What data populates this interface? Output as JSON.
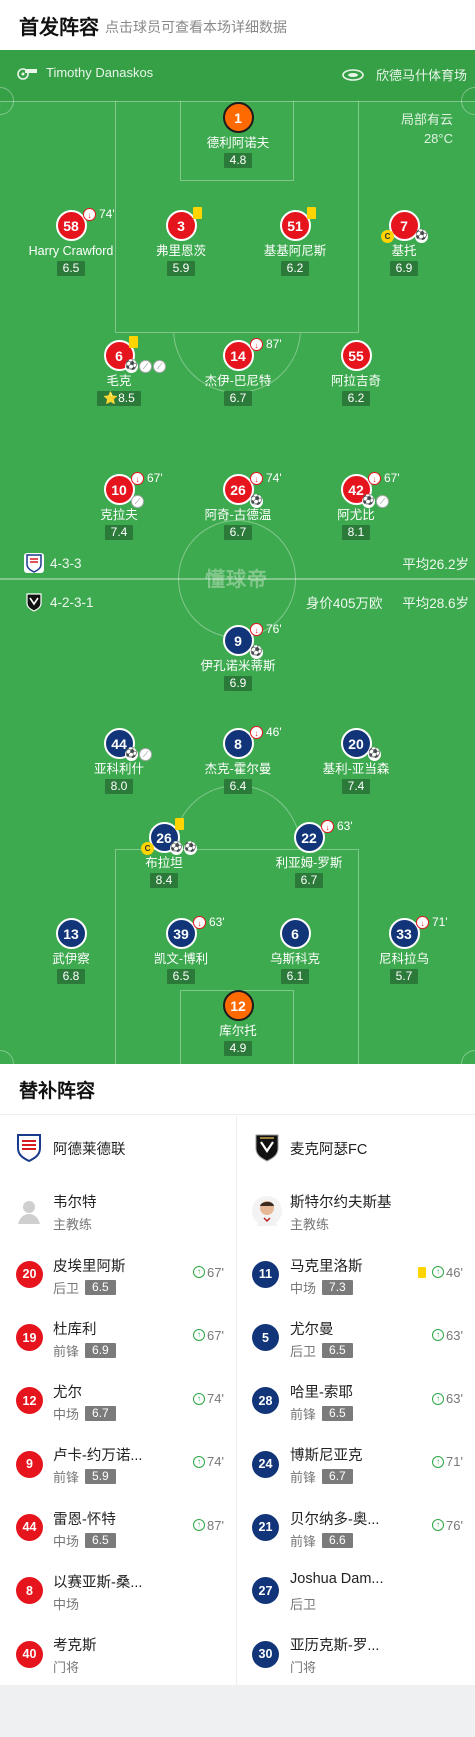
{
  "header": {
    "title": "首发阵容",
    "subtitle": "点击球员可查看本场详细数据"
  },
  "info": {
    "referee": "Timothy Danaskos",
    "venue": "欣德马什体育场",
    "weather": "局部有云",
    "temperature": "28°C"
  },
  "watermark": "懂球帝",
  "home": {
    "formation": "4-3-3",
    "avg_age": "平均26.2岁",
    "players": [
      {
        "num": "1",
        "name": "德利阿诺夫",
        "rating": "4.8",
        "color": "orange"
      },
      {
        "num": "58",
        "name": "Harry Crawford",
        "rating": "6.5",
        "sub_min": "74'",
        "color": "red"
      },
      {
        "num": "3",
        "name": "弗里恩茨",
        "rating": "5.9",
        "color": "red"
      },
      {
        "num": "51",
        "name": "基基阿尼斯",
        "rating": "6.2",
        "color": "red"
      },
      {
        "num": "7",
        "name": "基托",
        "rating": "6.9",
        "color": "red"
      },
      {
        "num": "6",
        "name": "毛克",
        "rating": "8.5",
        "color": "red",
        "star": "⭐"
      },
      {
        "num": "14",
        "name": "杰伊-巴尼特",
        "rating": "6.7",
        "sub_min": "87'",
        "color": "red"
      },
      {
        "num": "55",
        "name": "阿拉吉奇",
        "rating": "6.2",
        "color": "red"
      },
      {
        "num": "10",
        "name": "克拉夫",
        "rating": "7.4",
        "sub_min": "67'",
        "color": "red"
      },
      {
        "num": "26",
        "name": "阿奇-古德温",
        "rating": "6.7",
        "sub_min": "74'",
        "color": "red"
      },
      {
        "num": "42",
        "name": "阿尤比",
        "rating": "8.1",
        "sub_min": "67'",
        "color": "red"
      }
    ]
  },
  "away": {
    "formation": "4-2-3-1",
    "market_value": "身价405万欧",
    "avg_age": "平均28.6岁",
    "players": [
      {
        "num": "9",
        "name": "伊孔诺米蒂斯",
        "rating": "6.9",
        "sub_min": "76'",
        "color": "blue"
      },
      {
        "num": "44",
        "name": "亚科利什",
        "rating": "8.0",
        "color": "blue"
      },
      {
        "num": "8",
        "name": "杰克-霍尔曼",
        "rating": "6.4",
        "sub_min": "46'",
        "color": "blue"
      },
      {
        "num": "20",
        "name": "基利-亚当森",
        "rating": "7.4",
        "color": "blue"
      },
      {
        "num": "26",
        "name": "布拉坦",
        "rating": "8.4",
        "color": "blue"
      },
      {
        "num": "22",
        "name": "利亚姆-罗斯",
        "rating": "6.7",
        "sub_min": "63'",
        "color": "blue"
      },
      {
        "num": "13",
        "name": "武伊察",
        "rating": "6.8",
        "color": "blue"
      },
      {
        "num": "39",
        "name": "凯文-博利",
        "rating": "6.5",
        "sub_min": "63'",
        "color": "blue"
      },
      {
        "num": "6",
        "name": "乌斯科克",
        "rating": "6.1",
        "color": "blue"
      },
      {
        "num": "33",
        "name": "尼科拉乌",
        "rating": "5.7",
        "sub_min": "71'",
        "color": "blue"
      },
      {
        "num": "12",
        "name": "库尔托",
        "rating": "4.9",
        "color": "orange"
      }
    ]
  },
  "subs": {
    "title": "替补阵容",
    "home_team": "阿德莱德联",
    "away_team": "麦克阿瑟FC",
    "home_coach": {
      "name": "韦尔特",
      "role": "主教练"
    },
    "away_coach": {
      "name": "斯特尔约夫斯基",
      "role": "主教练"
    },
    "home": [
      {
        "num": "20",
        "name": "皮埃里阿斯",
        "pos": "后卫",
        "rating": "6.5",
        "in": "67'"
      },
      {
        "num": "19",
        "name": "杜库利",
        "pos": "前锋",
        "rating": "6.9",
        "in": "67'"
      },
      {
        "num": "12",
        "name": "尤尔",
        "pos": "中场",
        "rating": "6.7",
        "in": "74'"
      },
      {
        "num": "9",
        "name": "卢卡-约万诺...",
        "pos": "前锋",
        "rating": "5.9",
        "in": "74'"
      },
      {
        "num": "44",
        "name": "雷恩-怀特",
        "pos": "中场",
        "rating": "6.5",
        "in": "87'"
      },
      {
        "num": "8",
        "name": "以赛亚斯-桑...",
        "pos": "中场",
        "rating": "",
        "in": ""
      },
      {
        "num": "40",
        "name": "考克斯",
        "pos": "门将",
        "rating": "",
        "in": ""
      }
    ],
    "away": [
      {
        "num": "11",
        "name": "马克里洛斯",
        "pos": "中场",
        "rating": "7.3",
        "in": "46'",
        "yellow": true
      },
      {
        "num": "5",
        "name": "尤尔曼",
        "pos": "后卫",
        "rating": "6.5",
        "in": "63'"
      },
      {
        "num": "28",
        "name": "哈里-索耶",
        "pos": "前锋",
        "rating": "6.5",
        "in": "63'"
      },
      {
        "num": "24",
        "name": "博斯尼亚克",
        "pos": "前锋",
        "rating": "6.7",
        "in": "71'"
      },
      {
        "num": "21",
        "name": "贝尔纳多-奥...",
        "pos": "前锋",
        "rating": "6.6",
        "in": "76'"
      },
      {
        "num": "27",
        "name": "Joshua Dam...",
        "pos": "后卫",
        "rating": "",
        "in": ""
      },
      {
        "num": "30",
        "name": "亚历克斯-罗...",
        "pos": "门将",
        "rating": "",
        "in": ""
      }
    ]
  }
}
